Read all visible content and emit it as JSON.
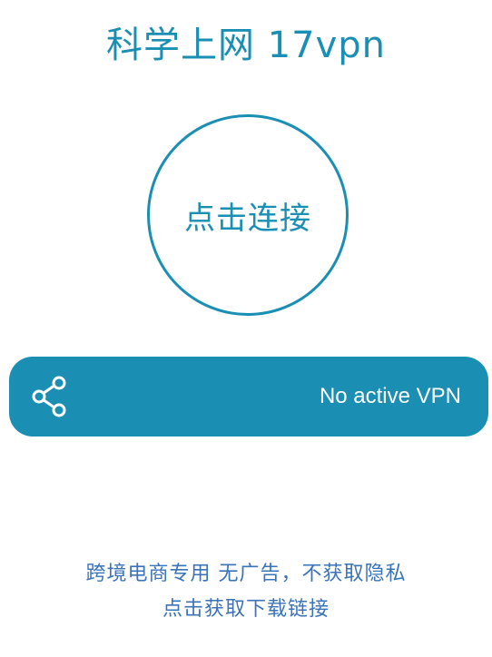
{
  "app": {
    "title": "科学上网 17vpn"
  },
  "connect": {
    "label": "点击连接"
  },
  "status": {
    "share_icon": "share-icon",
    "text": "No active VPN"
  },
  "promo": {
    "line1": "跨境电商专用  无广告，不获取隐私",
    "line2": "点击获取下载链接"
  },
  "colors": {
    "accent": "#1a8fb3",
    "promo_text": "#3a73b8",
    "background": "#ffffff"
  }
}
